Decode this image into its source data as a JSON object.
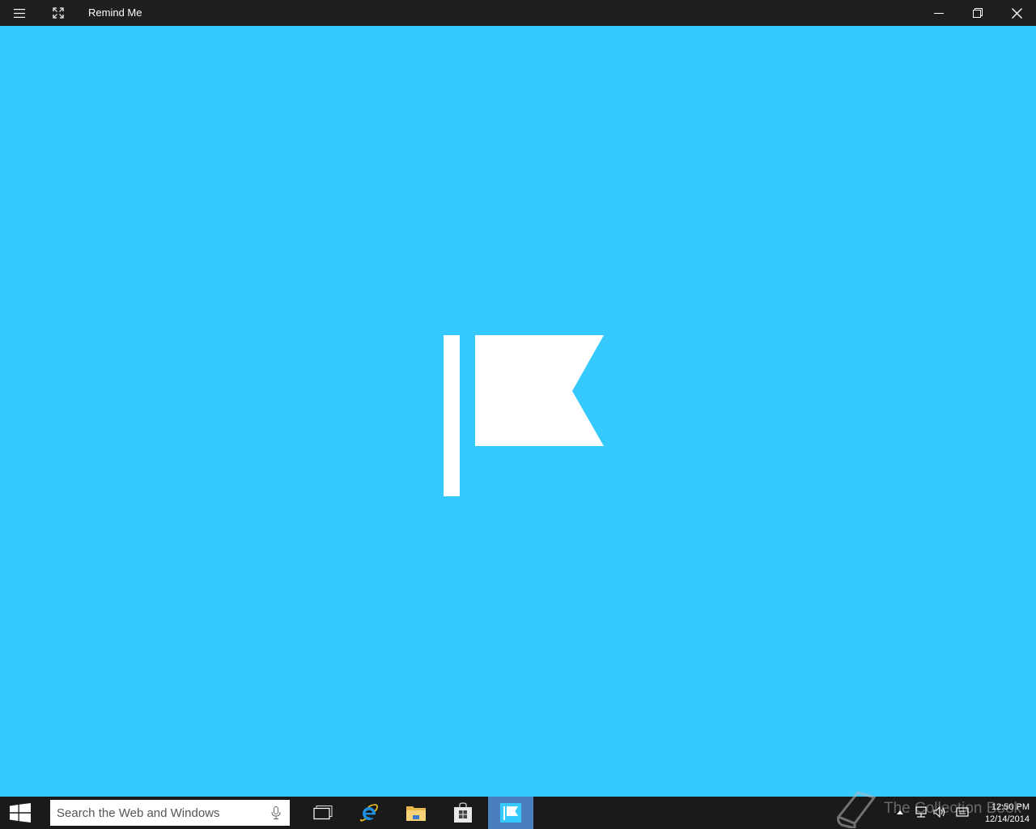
{
  "window": {
    "title": "Remind Me",
    "icons": {
      "menu": "hamburger-icon",
      "fullscreen": "fullscreen-icon",
      "minimize": "minimize-icon",
      "restore": "restore-icon",
      "close": "close-icon"
    }
  },
  "app": {
    "background_color": "#35c9fd",
    "splash_icon": "flag-icon"
  },
  "taskbar": {
    "search": {
      "placeholder": "Search the Web and Windows",
      "icon": "microphone-icon"
    },
    "apps": [
      {
        "name": "task-view",
        "icon": "task-view-icon",
        "active": false
      },
      {
        "name": "internet-explorer",
        "icon": "internet-explorer-icon",
        "active": false
      },
      {
        "name": "file-explorer",
        "icon": "folder-icon",
        "active": false
      },
      {
        "name": "store",
        "icon": "store-icon",
        "active": false
      },
      {
        "name": "remind-me",
        "icon": "flag-icon",
        "active": true
      }
    ],
    "watermark": "The Collection Book",
    "tray": {
      "icons": [
        "chevron-up-icon",
        "network-icon",
        "volume-icon",
        "notification-icon"
      ],
      "time": "12:50 PM",
      "date": "12/14/2014"
    }
  }
}
